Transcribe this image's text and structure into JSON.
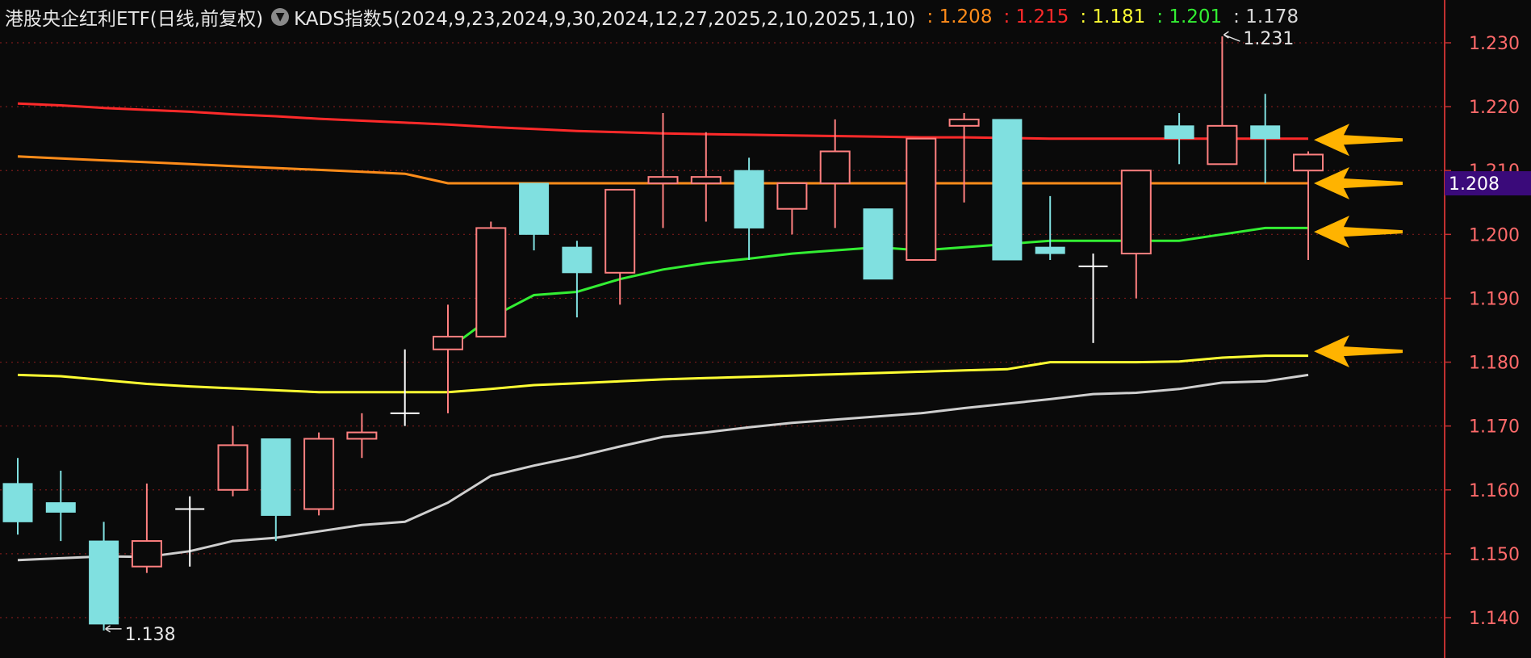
{
  "header": {
    "title": "港股央企红利ETF(日线,前复权)",
    "indicator": "KADS指数5(2024,9,23,2024,9,30,2024,12,27,2025,2,10,2025,1,10)",
    "values": [
      {
        "text": ": 1.208",
        "color": "#ff8c1a"
      },
      {
        "text": ": 1.215",
        "color": "#ff2a2a"
      },
      {
        "text": ": 1.181",
        "color": "#ffff33"
      },
      {
        "text": ": 1.201",
        "color": "#33ee33"
      },
      {
        "text": ": 1.178",
        "color": "#d8d8d8"
      }
    ]
  },
  "current_price_label": "1.208",
  "chart_data": {
    "type": "candlestick",
    "ylim": [
      1.135,
      1.233
    ],
    "y_ticks": [
      "1.140",
      "1.150",
      "1.160",
      "1.170",
      "1.180",
      "1.190",
      "1.200",
      "1.210",
      "1.220",
      "1.230"
    ],
    "colors": {
      "up": "#ff8080",
      "down": "#80e0e0",
      "doji": "#ffffff",
      "grid": "#7a1a1a"
    },
    "candles": [
      {
        "o": 1.161,
        "h": 1.165,
        "l": 1.153,
        "c": 1.155
      },
      {
        "o": 1.158,
        "h": 1.163,
        "l": 1.152,
        "c": 1.1565
      },
      {
        "o": 1.152,
        "h": 1.155,
        "l": 1.138,
        "c": 1.139
      },
      {
        "o": 1.148,
        "h": 1.161,
        "l": 1.147,
        "c": 1.152
      },
      {
        "o": 1.157,
        "h": 1.159,
        "l": 1.148,
        "c": 1.157
      },
      {
        "o": 1.16,
        "h": 1.17,
        "l": 1.159,
        "c": 1.167
      },
      {
        "o": 1.168,
        "h": 1.168,
        "l": 1.152,
        "c": 1.156
      },
      {
        "o": 1.157,
        "h": 1.169,
        "l": 1.156,
        "c": 1.168
      },
      {
        "o": 1.168,
        "h": 1.172,
        "l": 1.165,
        "c": 1.169
      },
      {
        "o": 1.172,
        "h": 1.182,
        "l": 1.17,
        "c": 1.172
      },
      {
        "o": 1.182,
        "h": 1.189,
        "l": 1.172,
        "c": 1.184
      },
      {
        "o": 1.184,
        "h": 1.202,
        "l": 1.184,
        "c": 1.201
      },
      {
        "o": 1.208,
        "h": 1.208,
        "l": 1.1975,
        "c": 1.2
      },
      {
        "o": 1.198,
        "h": 1.199,
        "l": 1.187,
        "c": 1.194
      },
      {
        "o": 1.194,
        "h": 1.207,
        "l": 1.189,
        "c": 1.207
      },
      {
        "o": 1.208,
        "h": 1.219,
        "l": 1.201,
        "c": 1.209
      },
      {
        "o": 1.208,
        "h": 1.216,
        "l": 1.202,
        "c": 1.209
      },
      {
        "o": 1.21,
        "h": 1.212,
        "l": 1.196,
        "c": 1.201
      },
      {
        "o": 1.204,
        "h": 1.208,
        "l": 1.2,
        "c": 1.208
      },
      {
        "o": 1.208,
        "h": 1.218,
        "l": 1.201,
        "c": 1.213
      },
      {
        "o": 1.204,
        "h": 1.204,
        "l": 1.193,
        "c": 1.193
      },
      {
        "o": 1.196,
        "h": 1.215,
        "l": 1.196,
        "c": 1.215
      },
      {
        "o": 1.217,
        "h": 1.219,
        "l": 1.205,
        "c": 1.218
      },
      {
        "o": 1.218,
        "h": 1.218,
        "l": 1.196,
        "c": 1.196
      },
      {
        "o": 1.198,
        "h": 1.206,
        "l": 1.196,
        "c": 1.197
      },
      {
        "o": 1.195,
        "h": 1.197,
        "l": 1.183,
        "c": 1.195
      },
      {
        "o": 1.197,
        "h": 1.21,
        "l": 1.19,
        "c": 1.21
      },
      {
        "o": 1.217,
        "h": 1.219,
        "l": 1.211,
        "c": 1.215
      },
      {
        "o": 1.211,
        "h": 1.231,
        "l": 1.211,
        "c": 1.217
      },
      {
        "o": 1.217,
        "h": 1.222,
        "l": 1.208,
        "c": 1.215
      },
      {
        "o": 1.21,
        "h": 1.213,
        "l": 1.196,
        "c": 1.2125
      }
    ],
    "series": [
      {
        "color": "#ff2a2a",
        "start": 0,
        "values": [
          1.2205,
          1.2202,
          1.2198,
          1.2195,
          1.2192,
          1.2188,
          1.2185,
          1.2181,
          1.2178,
          1.2175,
          1.2172,
          1.2168,
          1.2165,
          1.2162,
          1.216,
          1.2158,
          1.2157,
          1.2156,
          1.2155,
          1.2154,
          1.2153,
          1.2152,
          1.2152,
          1.2151,
          1.215,
          1.215,
          1.215,
          1.215,
          1.215,
          1.215,
          1.215
        ]
      },
      {
        "color": "#ff8c1a",
        "start": 0,
        "values": [
          1.2122,
          1.2119,
          1.2116,
          1.2113,
          1.211,
          1.2107,
          1.2104,
          1.2101,
          1.2098,
          1.2095,
          1.208,
          1.208,
          1.208,
          1.208,
          1.208,
          1.208,
          1.208,
          1.208,
          1.208,
          1.208,
          1.208,
          1.208,
          1.208,
          1.208,
          1.208,
          1.208,
          1.208,
          1.208,
          1.208,
          1.208,
          1.208
        ]
      },
      {
        "color": "#ffff33",
        "start": 0,
        "values": [
          1.178,
          1.1778,
          1.1772,
          1.1766,
          1.1762,
          1.1759,
          1.1756,
          1.1753,
          1.1753,
          1.1753,
          1.1753,
          1.1758,
          1.1764,
          1.1767,
          1.177,
          1.1773,
          1.1775,
          1.1777,
          1.1779,
          1.1781,
          1.1783,
          1.1785,
          1.1787,
          1.1789,
          1.18,
          1.18,
          1.18,
          1.1801,
          1.1807,
          1.181,
          1.181
        ]
      },
      {
        "color": "#33ee33",
        "start": 10,
        "values": [
          1.182,
          1.187,
          1.1905,
          1.191,
          1.193,
          1.1945,
          1.1955,
          1.1962,
          1.197,
          1.1975,
          1.198,
          1.1975,
          1.198,
          1.1985,
          1.199,
          1.199,
          1.199,
          1.199,
          1.2,
          1.201,
          1.201
        ]
      },
      {
        "color": "#cfcfcf",
        "start": 0,
        "values": [
          1.149,
          1.1493,
          1.1496,
          1.1495,
          1.1504,
          1.152,
          1.1525,
          1.1535,
          1.1545,
          1.155,
          1.158,
          1.1622,
          1.1638,
          1.1652,
          1.1668,
          1.1683,
          1.169,
          1.1698,
          1.1705,
          1.171,
          1.1715,
          1.172,
          1.1728,
          1.1735,
          1.1742,
          1.175,
          1.1752,
          1.1758,
          1.1768,
          1.177,
          1.178
        ]
      }
    ],
    "annotations": [
      {
        "text": "1.231",
        "candle": 28,
        "value": 1.231,
        "kind": "high"
      },
      {
        "text": "1.138",
        "candle": 2,
        "value": 1.138,
        "kind": "low"
      }
    ],
    "arrow_markers": [
      1.2148,
      1.208,
      1.2004,
      1.1817
    ]
  }
}
